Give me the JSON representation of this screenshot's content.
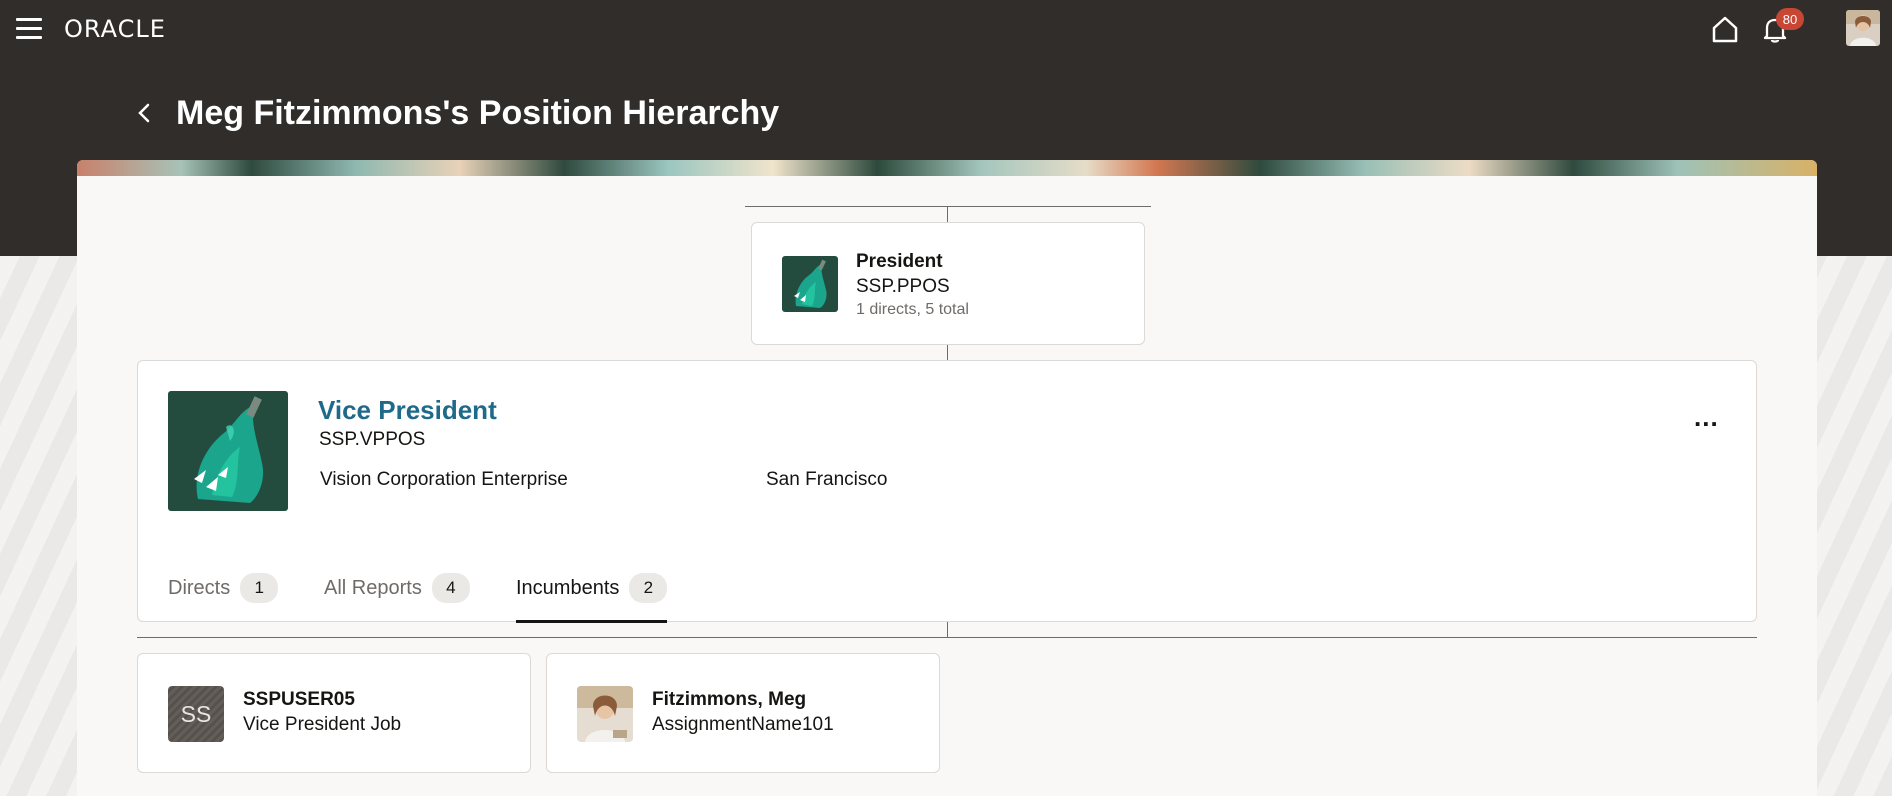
{
  "header": {
    "brand": "ORACLE",
    "notification_count": "80",
    "icons": [
      "hamburger-menu-icon",
      "home-icon",
      "bell-icon",
      "user-avatar"
    ]
  },
  "page": {
    "title": "Meg Fitzimmons's Position Hierarchy"
  },
  "parent_position": {
    "title": "President",
    "code": "SSP.PPOS",
    "counts": "1 directs, 5 total"
  },
  "position": {
    "title": "Vice President",
    "code": "SSP.VPPOS",
    "organization": "Vision Corporation Enterprise",
    "location": "San Francisco",
    "more_label": "..."
  },
  "tabs": [
    {
      "label": "Directs",
      "count": "1"
    },
    {
      "label": "All Reports",
      "count": "4"
    },
    {
      "label": "Incumbents",
      "count": "2"
    }
  ],
  "incumbents": [
    {
      "initials": "SS",
      "name": "SSPUSER05",
      "job": "Vice President Job"
    },
    {
      "name": "Fitzimmons, Meg",
      "job": "AssignmentName101"
    }
  ],
  "colors": {
    "header_bg": "#312d2a",
    "link": "#1f6a8a",
    "badge": "#c74634"
  }
}
